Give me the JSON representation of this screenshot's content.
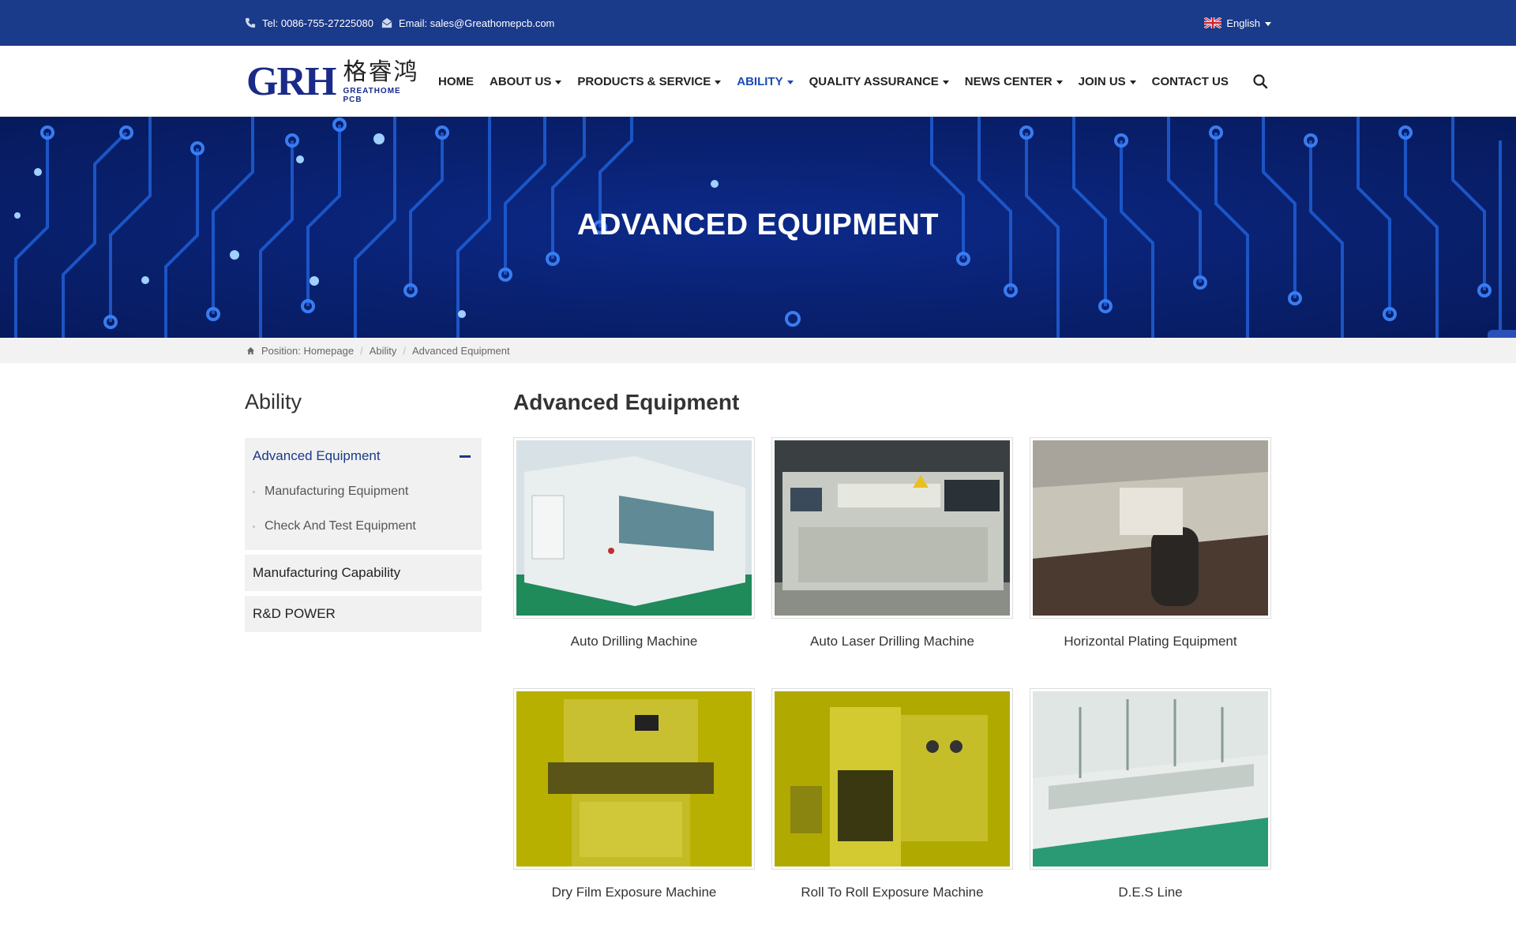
{
  "topbar": {
    "tel": "Tel: 0086-755-27225080",
    "email": "Email: sales@Greathomepcb.com",
    "language": "English"
  },
  "logo": {
    "mark": "GRH",
    "chinese": "格睿鸿",
    "english": "GREATHOME PCB"
  },
  "nav": {
    "items": [
      {
        "label": "HOME",
        "dropdown": false
      },
      {
        "label": "ABOUT US",
        "dropdown": true
      },
      {
        "label": "PRODUCTS & SERVICE",
        "dropdown": true
      },
      {
        "label": "ABILITY",
        "dropdown": true,
        "active": true
      },
      {
        "label": "QUALITY ASSURANCE",
        "dropdown": true
      },
      {
        "label": "NEWS CENTER",
        "dropdown": true
      },
      {
        "label": "JOIN US",
        "dropdown": true
      },
      {
        "label": "CONTACT US",
        "dropdown": false
      }
    ]
  },
  "banner": {
    "title": "ADVANCED EQUIPMENT"
  },
  "breadcrumb": {
    "position": "Position: Homepage",
    "level1": "Ability",
    "level2": "Advanced Equipment"
  },
  "sidebar": {
    "title": "Ability",
    "groups": [
      {
        "label": "Advanced Equipment",
        "expanded": true,
        "items": [
          "Manufacturing Equipment",
          "Check And Test Equipment"
        ]
      },
      {
        "label": "Manufacturing Capability"
      },
      {
        "label": "R&D POWER"
      }
    ]
  },
  "content": {
    "title": "Advanced Equipment",
    "cards": [
      {
        "caption": "Auto Drilling Machine"
      },
      {
        "caption": "Auto Laser Drilling Machine"
      },
      {
        "caption": "Horizontal Plating Equipment"
      },
      {
        "caption": "Dry Film Exposure Machine"
      },
      {
        "caption": "Roll To Roll Exposure Machine"
      },
      {
        "caption": "D.E.S Line"
      }
    ]
  },
  "colors": {
    "topbar": "#1a3a8a",
    "accent": "#1a4bb5",
    "banner": "#0a2274"
  },
  "icons": [
    "phone-icon",
    "mail-icon",
    "uk-flag-icon",
    "search-icon",
    "home-icon",
    "whatsapp-icon",
    "envelope-icon"
  ]
}
